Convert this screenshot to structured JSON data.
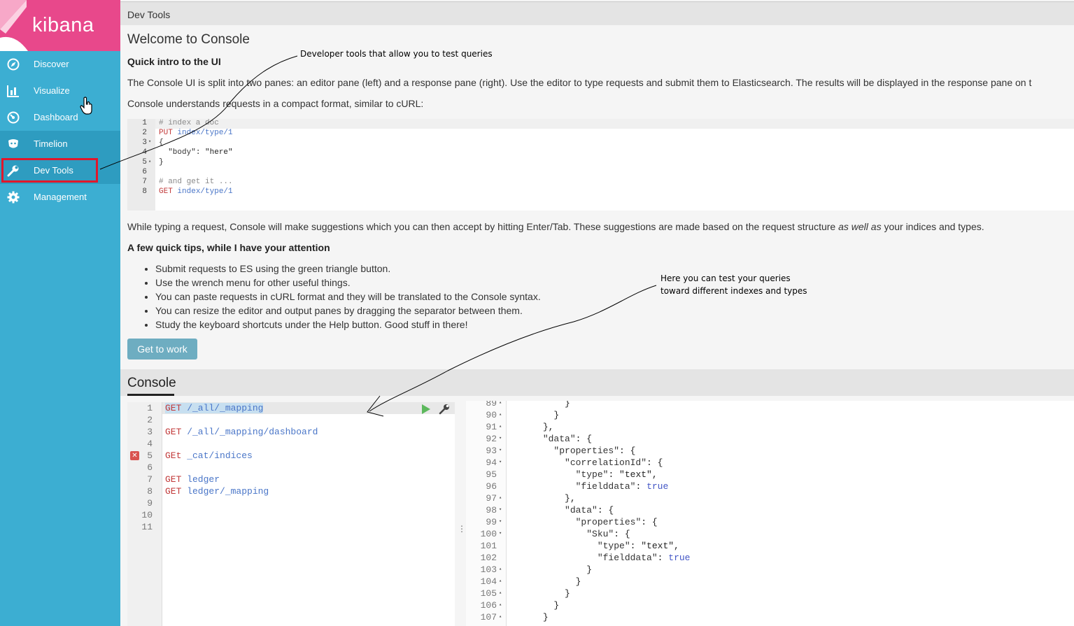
{
  "header": {
    "title": "Dev Tools"
  },
  "sidebar": {
    "brand": "kibana",
    "items": [
      {
        "label": "Discover",
        "icon": "compass-icon"
      },
      {
        "label": "Visualize",
        "icon": "bar-chart-icon"
      },
      {
        "label": "Dashboard",
        "icon": "dashboard-icon"
      },
      {
        "label": "Timelion",
        "icon": "timelion-icon"
      },
      {
        "label": "Dev Tools",
        "icon": "wrench-icon"
      },
      {
        "label": "Management",
        "icon": "gear-icon"
      }
    ]
  },
  "welcome": {
    "title": "Welcome to Console",
    "intro_heading": "Quick intro to the UI",
    "intro_p1": "The Console UI is split into two panes: an editor pane (left) and a response pane (right). Use the editor to type requests and submit them to Elasticsearch. The results will be displayed in the response pane on t",
    "intro_p2": "Console understands requests in a compact format, similar to cURL:",
    "sample_code": [
      {
        "n": "1",
        "fold": "",
        "text": "# index a doc"
      },
      {
        "n": "2",
        "fold": "",
        "method": "PUT",
        "text": " index/type/1"
      },
      {
        "n": "3",
        "fold": "▾",
        "text": "{"
      },
      {
        "n": "4",
        "fold": "",
        "key": "  \"body\"",
        "text": ": \"here\""
      },
      {
        "n": "5",
        "fold": "▴",
        "text": "}"
      },
      {
        "n": "6",
        "fold": "",
        "text": ""
      },
      {
        "n": "7",
        "fold": "",
        "text": "# and get it ..."
      },
      {
        "n": "8",
        "fold": "",
        "method": "GET",
        "text": " index/type/1"
      }
    ],
    "typing_pre": "While typing a request, Console will make suggestions which you can then accept by hitting Enter/Tab. These suggestions are made based on the request structure ",
    "typing_em": "as well as",
    "typing_post": " your indices and types.",
    "tips_heading": "A few quick tips, while I have your attention",
    "tips": [
      "Submit requests to ES using the green triangle button.",
      "Use the wrench menu for other useful things.",
      "You can paste requests in cURL format and they will be translated to the Console syntax.",
      "You can resize the editor and output panes by dragging the separator between them.",
      "Study the keyboard shortcuts under the Help button. Good stuff in there!"
    ],
    "button_label": "Get to work"
  },
  "console": {
    "title": "Console",
    "editor_lines": [
      {
        "n": "1",
        "method": "GET",
        "url": " /_all/_mapping",
        "error": false
      },
      {
        "n": "2",
        "method": "",
        "url": "",
        "error": false
      },
      {
        "n": "3",
        "method": "GET",
        "url": " /_all/_mapping/dashboard",
        "error": false
      },
      {
        "n": "4",
        "method": "",
        "url": "",
        "error": false
      },
      {
        "n": "5",
        "method": "GEt",
        "url": " _cat/indices",
        "error": true
      },
      {
        "n": "6",
        "method": "",
        "url": "",
        "error": false
      },
      {
        "n": "7",
        "method": "GET",
        "url": " ledger",
        "error": false
      },
      {
        "n": "8",
        "method": "GET",
        "url": " ledger/_mapping",
        "error": false
      },
      {
        "n": "9",
        "method": "",
        "url": "",
        "error": false
      },
      {
        "n": "10",
        "method": "",
        "url": "",
        "error": false
      },
      {
        "n": "11",
        "method": "",
        "url": "",
        "error": false
      }
    ],
    "error_glyph": "✕",
    "output_lines": [
      {
        "n": "89",
        "fold": "▴",
        "indent": "          ",
        "key": "",
        "rest": "}"
      },
      {
        "n": "90",
        "fold": "▴",
        "indent": "        ",
        "key": "",
        "rest": "}"
      },
      {
        "n": "91",
        "fold": "▴",
        "indent": "      ",
        "key": "",
        "rest": "},"
      },
      {
        "n": "92",
        "fold": "▾",
        "indent": "      ",
        "key": "\"data\"",
        "rest": ": {"
      },
      {
        "n": "93",
        "fold": "▾",
        "indent": "        ",
        "key": "\"properties\"",
        "rest": ": {"
      },
      {
        "n": "94",
        "fold": "▾",
        "indent": "          ",
        "key": "\"correlationId\"",
        "rest": ": {"
      },
      {
        "n": "95",
        "fold": "",
        "indent": "            ",
        "key": "\"type\"",
        "rest": ": \"text\","
      },
      {
        "n": "96",
        "fold": "",
        "indent": "            ",
        "key": "\"fielddata\"",
        "rest": ": ",
        "bool": "true"
      },
      {
        "n": "97",
        "fold": "▴",
        "indent": "          ",
        "key": "",
        "rest": "},"
      },
      {
        "n": "98",
        "fold": "▾",
        "indent": "          ",
        "key": "\"data\"",
        "rest": ": {"
      },
      {
        "n": "99",
        "fold": "▾",
        "indent": "            ",
        "key": "\"properties\"",
        "rest": ": {"
      },
      {
        "n": "100",
        "fold": "▾",
        "indent": "              ",
        "key": "\"Sku\"",
        "rest": ": {"
      },
      {
        "n": "101",
        "fold": "",
        "indent": "                ",
        "key": "\"type\"",
        "rest": ": \"text\","
      },
      {
        "n": "102",
        "fold": "",
        "indent": "                ",
        "key": "\"fielddata\"",
        "rest": ": ",
        "bool": "true"
      },
      {
        "n": "103",
        "fold": "▴",
        "indent": "              ",
        "key": "",
        "rest": "}"
      },
      {
        "n": "104",
        "fold": "▴",
        "indent": "            ",
        "key": "",
        "rest": "}"
      },
      {
        "n": "105",
        "fold": "▴",
        "indent": "          ",
        "key": "",
        "rest": "}"
      },
      {
        "n": "106",
        "fold": "▴",
        "indent": "        ",
        "key": "",
        "rest": "}"
      },
      {
        "n": "107",
        "fold": "▴",
        "indent": "      ",
        "key": "",
        "rest": "}"
      }
    ]
  },
  "annotations": {
    "top": "Developer tools that allow you to test queries",
    "bottom_line1": "Here you can test your queries",
    "bottom_line2": "toward different indexes and types"
  },
  "colors": {
    "sidebar": "#3caed2",
    "logo": "#e8488b",
    "highlight": "#e1172b",
    "button": "#6eadc1",
    "run": "#5cb85c"
  }
}
